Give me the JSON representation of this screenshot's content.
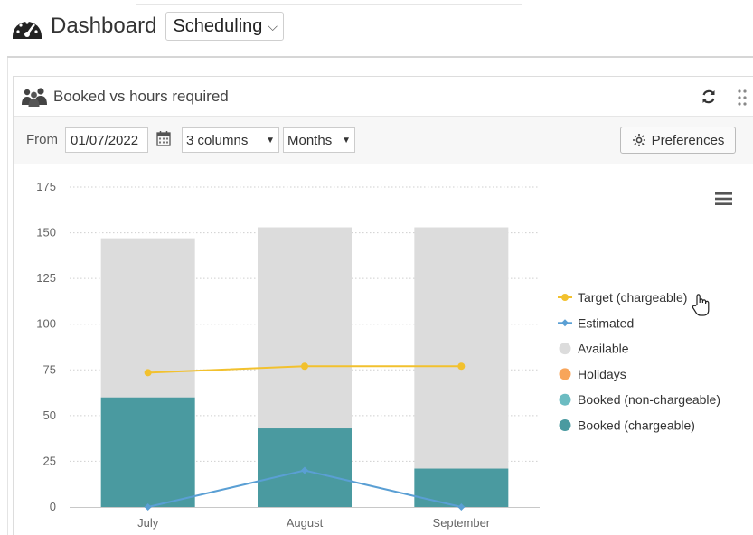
{
  "header": {
    "title": "Dashboard",
    "selector_value": "Scheduling"
  },
  "widget": {
    "title": "Booked vs hours required",
    "toolbar": {
      "from_label": "From",
      "date_value": "01/07/2022",
      "columns_value": "3 columns",
      "period_value": "Months",
      "preferences_label": "Preferences"
    }
  },
  "colors": {
    "target": "#f2c12e",
    "estimated": "#5a9fd4",
    "available": "#dcdcdc",
    "holidays": "#f8a55a",
    "booked_non_chargeable": "#6cbcc2",
    "booked_chargeable": "#4a9aa0"
  },
  "chart_data": {
    "type": "bar",
    "stacked": true,
    "categories": [
      "July",
      "August",
      "September"
    ],
    "ylim": [
      0,
      175
    ],
    "yticks": [
      0,
      25,
      50,
      75,
      100,
      125,
      150,
      175
    ],
    "grid": true,
    "legend_position": "right",
    "series": [
      {
        "name": "Target (chargeable)",
        "kind": "line",
        "color_key": "target",
        "values": [
          73.5,
          77,
          77
        ]
      },
      {
        "name": "Estimated",
        "kind": "line",
        "color_key": "estimated",
        "values": [
          0,
          20,
          0
        ]
      },
      {
        "name": "Available",
        "kind": "bar",
        "color_key": "available",
        "values": [
          87,
          110,
          132
        ]
      },
      {
        "name": "Holidays",
        "kind": "bar",
        "color_key": "holidays",
        "values": [
          0,
          0,
          0
        ]
      },
      {
        "name": "Booked (non-chargeable)",
        "kind": "bar",
        "color_key": "booked_non_chargeable",
        "values": [
          0,
          0,
          0
        ]
      },
      {
        "name": "Booked (chargeable)",
        "kind": "bar",
        "color_key": "booked_chargeable",
        "values": [
          60,
          43,
          21
        ]
      }
    ]
  }
}
